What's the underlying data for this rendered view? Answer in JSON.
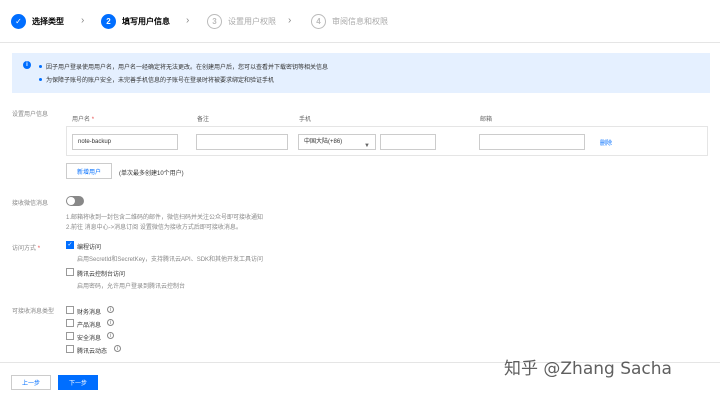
{
  "steps": [
    {
      "num": "✓",
      "label": "选择类型"
    },
    {
      "num": "2",
      "label": "填写用户信息"
    },
    {
      "num": "3",
      "label": "设置用户权限"
    },
    {
      "num": "4",
      "label": "审阅信息和权限"
    }
  ],
  "info": {
    "line1": "因子用户登录使用用户名，用户名一经确定将无法更改。在创建用户后，您可以查看并下载密钥等相关信息",
    "line2": "为保障子账号的账户安全，未完善手机信息的子账号在登录时将被要求绑定和验证手机"
  },
  "user_section": {
    "label": "设置用户信息",
    "columns": {
      "username": "用户名",
      "required": "*",
      "remark": "备注",
      "phone": "手机",
      "email": "邮箱"
    },
    "row": {
      "username": "note-backup",
      "remark": "",
      "country": "中国大陆(+86)",
      "phone": "",
      "email": "",
      "delete": "删除"
    },
    "add_button": "新增用户",
    "add_hint": "(单次最多创建10个用户)"
  },
  "notify": {
    "label": "接收微信消息",
    "toggle_on": false,
    "hint1": "1.邮箱将收到一封包含二维码的邮件，微信扫码并关注公众号即可接收通知",
    "hint2": "2.前往 消息中心->消息订阅 设置微信为接收方式后即可接收消息。"
  },
  "access": {
    "label": "访问方式",
    "required": "*",
    "options": [
      {
        "label": "编程访问",
        "checked": true,
        "desc": "启用SecretId和SecretKey，支持腾讯云API、SDK和其他开发工具访问"
      },
      {
        "label": "腾讯云控制台访问",
        "checked": false,
        "desc": "启用密码，允许用户登录到腾讯云控制台"
      }
    ]
  },
  "messages": {
    "label": "可接收消息类型",
    "options": [
      {
        "label": "财务消息",
        "checked": false
      },
      {
        "label": "产品消息",
        "checked": false
      },
      {
        "label": "安全消息",
        "checked": false
      },
      {
        "label": "腾讯云动态",
        "checked": false
      }
    ]
  },
  "footer": {
    "prev": "上一步",
    "next": "下一步"
  },
  "watermark": "知乎 @Zhang Sacha",
  "colors": {
    "primary": "#006eff",
    "info_bg": "#e5f0ff"
  }
}
